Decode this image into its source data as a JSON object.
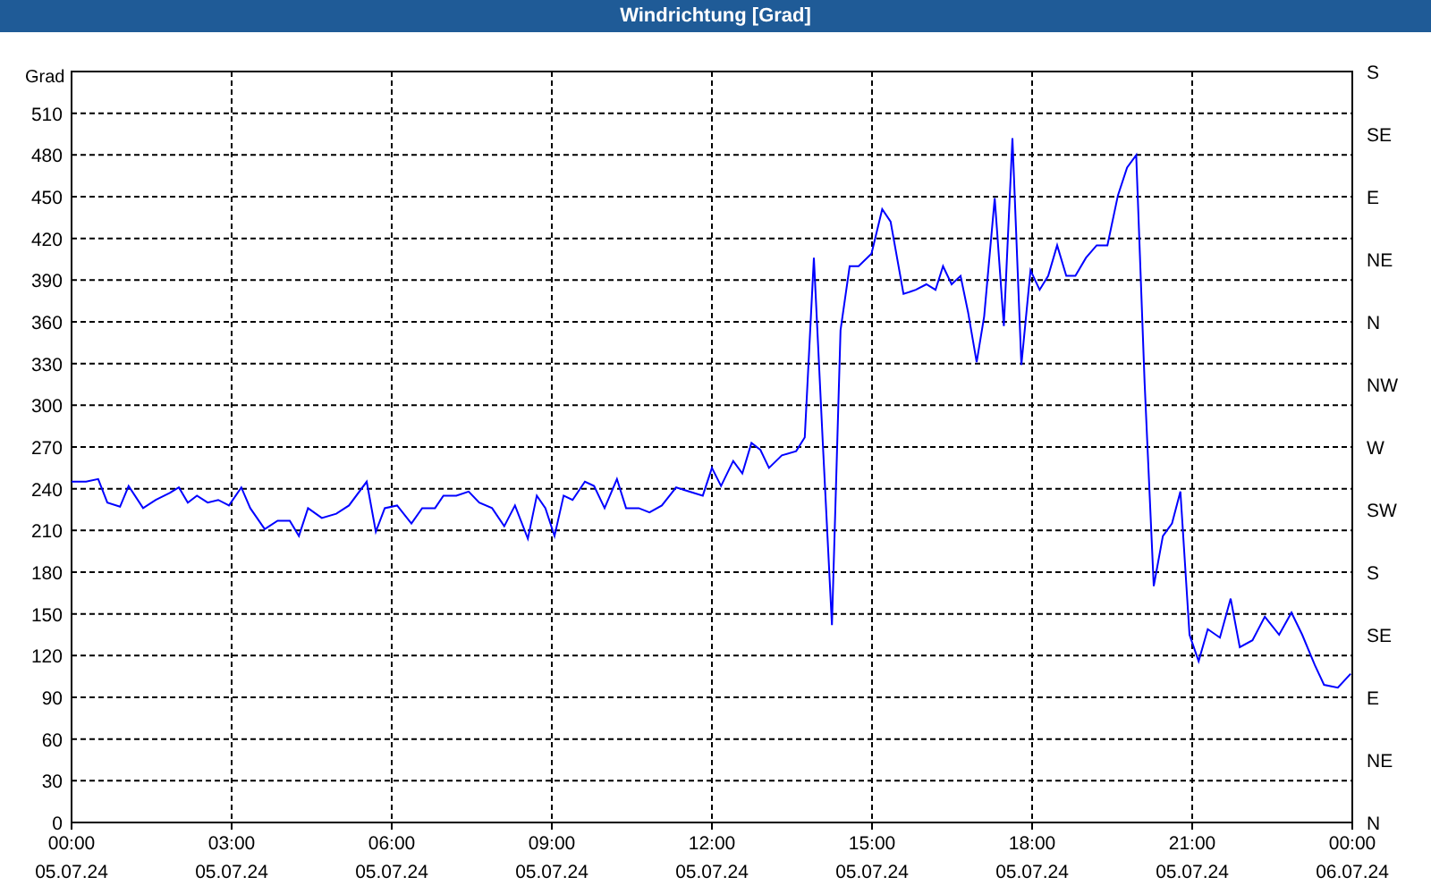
{
  "window": {
    "title": "Windrichtung [Grad]"
  },
  "x_date_labels": [
    "05.07.24",
    "05.07.24",
    "05.07.24",
    "05.07.24",
    "05.07.24",
    "05.07.24",
    "05.07.24",
    "05.07.24",
    "06.07.24"
  ],
  "compass_axis_labels": [
    "S",
    "SE",
    "E",
    "NE",
    "N",
    "NW",
    "W",
    "SW",
    "S",
    "SE",
    "E",
    "NE",
    "N"
  ],
  "chart_data": {
    "type": "line",
    "ylabel": "Grad",
    "xlim": [
      0,
      24
    ],
    "ylim": [
      0,
      540
    ],
    "xticks": [
      {
        "value": 0,
        "label": "00:00"
      },
      {
        "value": 3,
        "label": "03:00"
      },
      {
        "value": 6,
        "label": "06:00"
      },
      {
        "value": 9,
        "label": "09:00"
      },
      {
        "value": 12,
        "label": "12:00"
      },
      {
        "value": 15,
        "label": "15:00"
      },
      {
        "value": 18,
        "label": "18:00"
      },
      {
        "value": 21,
        "label": "21:00"
      },
      {
        "value": 24,
        "label": "00:00"
      }
    ],
    "grid": true,
    "yticks": [
      0,
      30,
      60,
      90,
      120,
      150,
      180,
      210,
      240,
      270,
      300,
      330,
      360,
      390,
      420,
      450,
      480,
      510
    ],
    "x": [
      0,
      0.27,
      0.5,
      0.67,
      0.91,
      1.07,
      1.34,
      1.58,
      1.84,
      2.01,
      2.18,
      2.35,
      2.55,
      2.75,
      2.95,
      3.18,
      3.35,
      3.62,
      3.86,
      4.09,
      4.26,
      4.43,
      4.69,
      4.96,
      5.2,
      5.53,
      5.7,
      5.87,
      6.1,
      6.37,
      6.57,
      6.81,
      6.97,
      7.21,
      7.44,
      7.64,
      7.88,
      8.11,
      8.31,
      8.55,
      8.72,
      8.88,
      9.05,
      9.22,
      9.39,
      9.62,
      9.79,
      9.99,
      10.22,
      10.39,
      10.63,
      10.83,
      11.06,
      11.33,
      11.57,
      11.83,
      12,
      12.17,
      12.4,
      12.57,
      12.74,
      12.91,
      13.07,
      13.31,
      13.58,
      13.74,
      13.91,
      14.08,
      14.25,
      14.41,
      14.58,
      14.75,
      14.99,
      15.19,
      15.35,
      15.59,
      15.82,
      16.02,
      16.19,
      16.33,
      16.49,
      16.66,
      16.8,
      16.96,
      17.1,
      17.3,
      17.47,
      17.63,
      17.8,
      17.97,
      18.14,
      18.3,
      18.47,
      18.64,
      18.81,
      19.01,
      19.21,
      19.41,
      19.61,
      19.78,
      19.95,
      20.11,
      20.28,
      20.45,
      20.62,
      20.78,
      20.95,
      21.12,
      21.29,
      21.52,
      21.72,
      21.89,
      22.13,
      22.36,
      22.63,
      22.86,
      23.06,
      23.3,
      23.47,
      23.73,
      23.97
    ],
    "values": [
      245,
      245,
      247,
      230,
      227,
      242,
      226,
      232,
      237,
      241,
      230,
      235,
      230,
      232,
      228,
      241,
      226,
      211,
      217,
      217,
      206,
      226,
      219,
      222,
      228,
      245,
      209,
      226,
      228,
      215,
      226,
      226,
      235,
      235,
      238,
      230,
      226,
      213,
      228,
      204,
      235,
      226,
      206,
      235,
      232,
      245,
      242,
      226,
      247,
      226,
      226,
      223,
      228,
      241,
      238,
      235,
      255,
      242,
      260,
      251,
      273,
      268,
      255,
      264,
      267,
      277,
      406,
      270,
      142,
      354,
      400,
      400,
      409,
      441,
      432,
      380,
      383,
      387,
      383,
      400,
      387,
      393,
      367,
      331,
      364,
      449,
      357,
      492,
      329,
      397,
      383,
      393,
      415,
      393,
      393,
      406,
      415,
      415,
      451,
      471,
      480,
      316,
      170,
      206,
      215,
      238,
      135,
      116,
      139,
      133,
      161,
      126,
      131,
      148,
      135,
      151,
      135,
      113,
      99,
      97,
      107
    ]
  }
}
